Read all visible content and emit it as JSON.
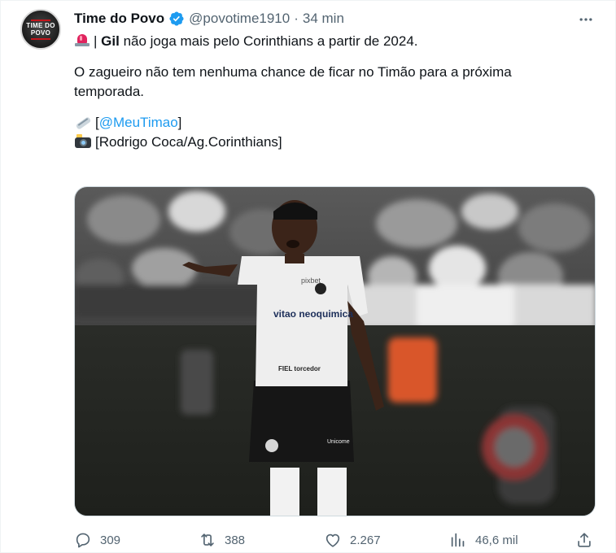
{
  "account": {
    "avatar_text": "TIME DO POVO",
    "name": "Time do Povo",
    "handle": "@povotime1910",
    "separator": "·",
    "time": "34 min"
  },
  "tweet": {
    "line1_separator": "|",
    "line1_bold": "Gil",
    "line1_rest": "não joga mais pelo Corinthians a partir de 2024.",
    "line2": "O zagueiro não tem nenhuma chance de ficar no Timão para a próxima",
    "line3": "temporada.",
    "source_open": "[",
    "source_link": "@MeuTimao",
    "source_close": "]",
    "photo_credit": "[Rodrigo Coca/Ag.Corinthians]"
  },
  "media": {
    "shirt_sponsor": "vitao neoquimica",
    "shirt_brand": "pixbet",
    "shirt_fiel": "FIEL torcedor",
    "shorts_sponsor": "Unicome"
  },
  "stats": {
    "replies": "309",
    "reposts": "388",
    "likes": "2.267",
    "views": "46,6 mil"
  },
  "icons": {
    "verified": "verified-badge-icon",
    "more": "more-options-icon",
    "reply": "reply-icon",
    "repost": "repost-icon",
    "like": "like-icon",
    "views": "views-icon",
    "share": "share-icon"
  },
  "colors": {
    "link": "#1d9bf0",
    "secondary_text": "#536471",
    "verified": "#1d9bf0"
  }
}
